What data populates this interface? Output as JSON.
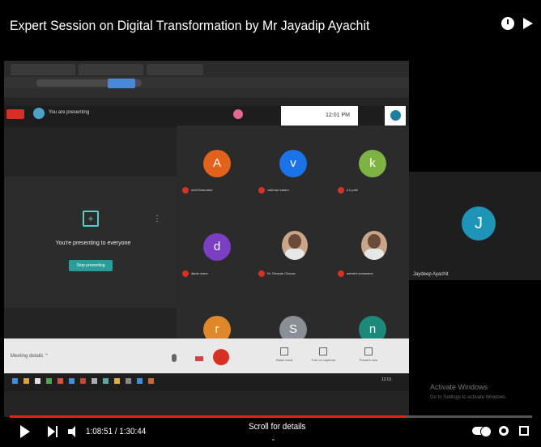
{
  "player": {
    "title": "Expert Session on Digital Transformation by Mr Jayadip Ayachit",
    "time": "1:08:51 / 1:30:44",
    "progress_fraction": 0.76,
    "scroll_hint": "Scroll for details",
    "scroll_arrow": "⌄"
  },
  "meet": {
    "you_presenting": "You are presenting",
    "clock": "12:01 PM",
    "presenting_to_everyone": "You're presenting to everyone",
    "stop_presenting": "Stop presenting",
    "more_dots": "⋮",
    "present_glyph": "+",
    "meeting_details": "Meeting details ⌃",
    "bottom_actions": [
      "Raise hand",
      "Turn on captions",
      "Present now"
    ],
    "participants": [
      {
        "initial": "A",
        "color": "#e2621b",
        "name": "Amit Bhandare"
      },
      {
        "initial": "v",
        "color": "#1a73e8",
        "name": "vaibhavi satam"
      },
      {
        "initial": "k",
        "color": "#7cb342",
        "name": "k k patil"
      },
      {
        "initial": "d",
        "color": "#7b3fc4",
        "name": "dipak mane"
      },
      {
        "initial": "",
        "color": "",
        "name": "Dr. Deepak Chavan",
        "photo": true
      },
      {
        "initial": "",
        "color": "",
        "name": "ashwini sonawane",
        "photo": true
      },
      {
        "initial": "r",
        "color": "#e0872a",
        "name": ""
      },
      {
        "initial": "S",
        "color": "#8a8f96",
        "name": ""
      },
      {
        "initial": "n",
        "color": "#1b8a7a",
        "name": ""
      }
    ],
    "side_participant": {
      "initial": "J",
      "name": "Jaydeep Ayachit"
    }
  },
  "windows": {
    "taskbar_time": "12:01",
    "activate_title": "Activate Windows",
    "activate_sub": "Go to Settings to activate Windows."
  },
  "colors": {
    "accent_red": "#e62117",
    "meet_teal": "#2a9d9a"
  },
  "icons": [
    "clock-icon",
    "share-icon",
    "play-icon",
    "next-icon",
    "volume-icon",
    "settings-icon",
    "fullscreen-icon",
    "autoplay-toggle"
  ]
}
